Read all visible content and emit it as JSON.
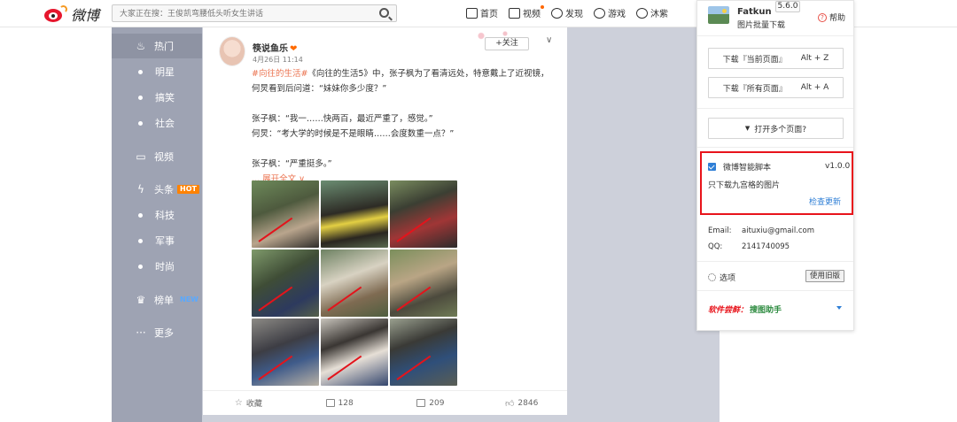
{
  "logo": {
    "text": "微博"
  },
  "search": {
    "placeholder": "大家正在搜：王俊凯弯腰低头听女生讲话"
  },
  "topnav": [
    {
      "label": "首页",
      "icon": "home-icon"
    },
    {
      "label": "视频",
      "icon": "video-icon"
    },
    {
      "label": "发现",
      "icon": "discover-icon"
    },
    {
      "label": "游戏",
      "icon": "game-icon"
    },
    {
      "label": "沐紫",
      "icon": "user-icon"
    }
  ],
  "sidebar": {
    "items": [
      {
        "label": "热门",
        "type": "main",
        "icon": "flame-icon",
        "active": true
      },
      {
        "label": "明星",
        "type": "sub"
      },
      {
        "label": "搞笑",
        "type": "sub"
      },
      {
        "label": "社会",
        "type": "sub"
      },
      {
        "label": "视频",
        "type": "main",
        "icon": "video-icon"
      },
      {
        "label": "头条",
        "type": "main",
        "icon": "lightning-icon",
        "badge": "HOT"
      },
      {
        "label": "科技",
        "type": "sub"
      },
      {
        "label": "军事",
        "type": "sub"
      },
      {
        "label": "时尚",
        "type": "sub"
      },
      {
        "label": "榜单",
        "type": "main",
        "icon": "trophy-icon",
        "badge": "NEW"
      },
      {
        "label": "更多",
        "type": "main",
        "icon": "more-icon"
      }
    ]
  },
  "post": {
    "username": "筷说鱼乐",
    "time": "4月26日 11:14",
    "follow_label": "+关注",
    "tag": "#向往的生活#",
    "line1_rest": "《向往的生活5》中，张子枫为了看清远处，特意戴上了近视镜，",
    "line2": "何炅看到后问道：“妹妹你多少度？”",
    "line3": "张子枫：“我一……快两百，最近严重了，感觉。”",
    "line4": "何炅：“考大学的时候是不是眼睛……会度数重一点？”",
    "line5": "张子枫：“严重挺多。”",
    "expand": "... 展开全文 ∨",
    "actions": {
      "favorite": "收藏",
      "repost": "128",
      "comment": "209",
      "like": "2846"
    }
  },
  "panel": {
    "name": "Fatkun",
    "subtitle": "图片批量下载",
    "version_badge": "5.6.0",
    "help": "帮助",
    "download_current": "下载『当前页面』",
    "download_current_key": "Alt + Z",
    "download_all": "下载『所有页面』",
    "download_all_key": "Alt + A",
    "open_multi": "打开多个页面?",
    "script_name": "微博智能脚本",
    "script_version": "v1.0.0",
    "script_desc": "只下载九宫格的图片",
    "check_update": "检查更新",
    "email_label": "Email:",
    "email_value": "aituxiu@gmail.com",
    "qq_label": "QQ:",
    "qq_value": "2141740095",
    "options": "选项",
    "old_version": "使用旧版",
    "recommend_prefix": "软件尝鲜：",
    "recommend_name": "搜图助手"
  }
}
